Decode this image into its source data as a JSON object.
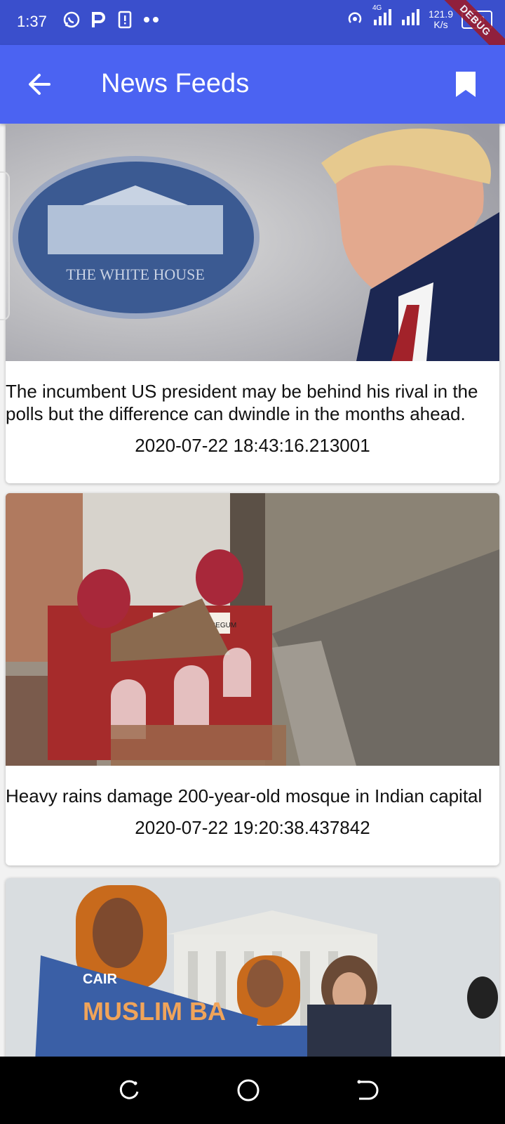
{
  "status_bar": {
    "time": "1:37",
    "net_type": "4G",
    "net_speed_value": "121.9",
    "net_speed_unit": "K/s",
    "battery": "100",
    "debug_label": "DEBUG"
  },
  "app_bar": {
    "title": "News Feeds"
  },
  "articles": [
    {
      "headline": "The incumbent US president may be behind his rival in the polls but the difference can dwindle in the months ahead.",
      "date": "2020-07-22 18:43:16.213001",
      "image_caption": "THE WHITE HOUSE"
    },
    {
      "headline": "Heavy rains damage 200-year-old mosque in Indian capital",
      "date": "2020-07-22 19:20:38.437842",
      "image_caption": "MASJID MUBARAK BEGUM"
    },
    {
      "image_caption": "CAIR",
      "sign_text": "MUSLIM BA"
    }
  ],
  "colors": {
    "status_bar": "#3a4fcc",
    "app_bar": "#4b63f2"
  }
}
